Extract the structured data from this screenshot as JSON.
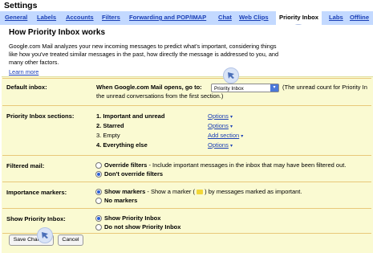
{
  "page_title": "Settings",
  "tabs": [
    {
      "label": "General"
    },
    {
      "label": "Labels"
    },
    {
      "label": "Accounts"
    },
    {
      "label": "Filters"
    },
    {
      "label": "Forwarding and POP/IMAP"
    },
    {
      "label": "Chat"
    },
    {
      "label": "Web Clips"
    },
    {
      "label": "Priority Inbox"
    },
    {
      "label": "Labs"
    },
    {
      "label": "Offline"
    }
  ],
  "info": {
    "title": "How Priority Inbox works",
    "description": "Google.com Mail analyzes your new incoming messages to predict what's important, considering things like how you've treated similar messages in the past, how directly the message is addressed to you, and many other factors.",
    "learn_more": "Learn more"
  },
  "default_inbox": {
    "label": "Default inbox:",
    "prompt": "When Google.com Mail opens, go to:",
    "selected": "Priority Inbox",
    "note_line1": "(The unread count for Priority In",
    "note_line2": "the unread conversations from the first section.)"
  },
  "sections": {
    "label": "Priority Inbox sections:",
    "items": [
      {
        "text": "1. Important and unread",
        "bold": true,
        "action": "Options"
      },
      {
        "text": "2. Starred",
        "bold": true,
        "action": "Options"
      },
      {
        "text": "3. Empty",
        "bold": false,
        "action": "Add section"
      },
      {
        "text": "4. Everything else",
        "bold": true,
        "action": "Options"
      }
    ]
  },
  "filtered_mail": {
    "label": "Filtered mail:",
    "opt1": "Override filters",
    "opt1_desc": " - Include important messages in the inbox that may have been filtered out.",
    "opt2": "Don't override filters",
    "selected": 2
  },
  "importance_markers": {
    "label": "Importance markers:",
    "opt1": "Show markers",
    "opt1_desc_a": " - Show a marker (",
    "opt1_desc_b": ") by messages marked as important.",
    "opt2": "No markers",
    "selected": 1
  },
  "show_priority": {
    "label": "Show Priority Inbox:",
    "opt1": "Show Priority Inbox",
    "opt2": "Do not show Priority Inbox",
    "selected": 1
  },
  "buttons": {
    "save": "Save Changes",
    "cancel": "Cancel"
  },
  "colors": {
    "tab_bar": "#c3d9ff",
    "panel": "#fafad2",
    "link": "#1a3fb6",
    "marker": "#f2d73a"
  }
}
